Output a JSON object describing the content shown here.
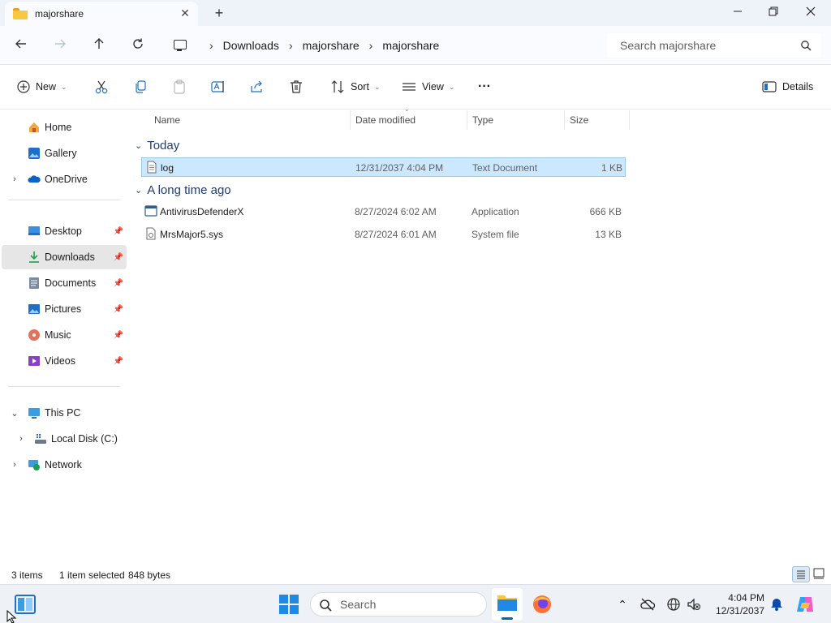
{
  "window": {
    "tab_title": "majorshare",
    "new_tab_symbol": "+",
    "close_tab_symbol": "✕",
    "minimize_symbol": "—",
    "maximize_symbol": "❐",
    "close_symbol": "✕"
  },
  "address": {
    "crumbs": [
      "Downloads",
      "majorshare",
      "majorshare"
    ],
    "search_placeholder": "Search majorshare"
  },
  "commands": {
    "new_label": "New",
    "sort_label": "Sort",
    "view_label": "View",
    "more_label": "···",
    "details_label": "Details"
  },
  "nav": {
    "items": [
      {
        "label": "Home",
        "icon": "home-icon"
      },
      {
        "label": "Gallery",
        "icon": "gallery-icon"
      },
      {
        "label": "OneDrive",
        "icon": "cloud-icon"
      },
      {
        "label": "Desktop",
        "icon": "desktop-icon",
        "pinned": true
      },
      {
        "label": "Downloads",
        "icon": "download-icon",
        "pinned": true,
        "selected": true
      },
      {
        "label": "Documents",
        "icon": "documents-icon",
        "pinned": true
      },
      {
        "label": "Pictures",
        "icon": "pictures-icon",
        "pinned": true
      },
      {
        "label": "Music",
        "icon": "music-icon",
        "pinned": true
      },
      {
        "label": "Videos",
        "icon": "videos-icon",
        "pinned": true
      },
      {
        "label": "This PC",
        "icon": "pc-icon"
      },
      {
        "label": "Local Disk (C:)",
        "icon": "disk-icon"
      },
      {
        "label": "Network",
        "icon": "network-icon"
      }
    ]
  },
  "columns": {
    "name": "Name",
    "date": "Date modified",
    "type": "Type",
    "size": "Size"
  },
  "groups": {
    "today": "Today",
    "long_ago": "A long time ago"
  },
  "files": [
    {
      "name": "log",
      "date": "12/31/2037 4:04 PM",
      "type": "Text Document",
      "size": "1 KB",
      "selected": true
    },
    {
      "name": "AntivirusDefenderX",
      "date": "8/27/2024 6:02 AM",
      "type": "Application",
      "size": "666 KB"
    },
    {
      "name": "MrsMajor5.sys",
      "date": "8/27/2024 6:01 AM",
      "type": "System file",
      "size": "13 KB"
    }
  ],
  "status": {
    "item_count": "3 items",
    "selection": "1 item selected",
    "selection_size": "848 bytes"
  },
  "taskbar": {
    "search_placeholder": "Search",
    "time": "4:04 PM",
    "date": "12/31/2037"
  },
  "colors": {
    "accent": "#0067c0",
    "selection_bg": "#cce8ff",
    "group_text": "#1f3d70"
  }
}
